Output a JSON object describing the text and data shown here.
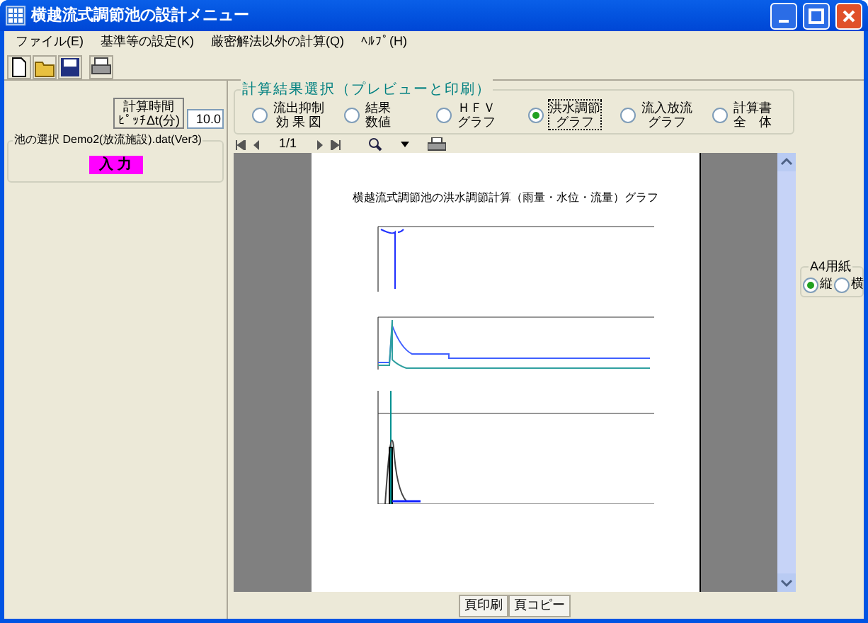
{
  "window": {
    "title": "横越流式調節池の設計メニュー"
  },
  "menu": [
    "ファイル(E)",
    "基準等の設定(K)",
    "厳密解法以外の計算(Q)",
    "ﾍﾙﾌﾟ(H)"
  ],
  "calc_time": {
    "label_lines": [
      "計算時間",
      "ﾋﾟｯﾁΔt(分)"
    ],
    "value": "10.0"
  },
  "pond": {
    "title": "池の選択 Demo2(放流施設).dat(Ver3)",
    "button": "入 力"
  },
  "results": {
    "title": "計算結果選択（プレビューと印刷）",
    "options": [
      {
        "lines": [
          "流出抑制",
          "効 果 図"
        ],
        "selected": false
      },
      {
        "lines": [
          "結果",
          "数値"
        ],
        "selected": false
      },
      {
        "lines": [
          "ＨＦＶ",
          "グラフ"
        ],
        "selected": false
      },
      {
        "lines": [
          "洪水調節",
          "グラフ"
        ],
        "selected": true
      },
      {
        "lines": [
          "流入放流",
          "グラフ"
        ],
        "selected": false
      },
      {
        "lines": [
          "計算書",
          "全　体"
        ],
        "selected": false
      }
    ]
  },
  "preview": {
    "page": "1/1",
    "graph_title": "横越流式調節池の洪水調節計算（雨量・水位・流量）グラフ"
  },
  "paper": {
    "title": "A4用紙",
    "options": [
      {
        "label": "縦",
        "selected": true
      },
      {
        "label": "横",
        "selected": false
      }
    ]
  },
  "buttons": [
    "頁印刷",
    "頁コピー"
  ]
}
